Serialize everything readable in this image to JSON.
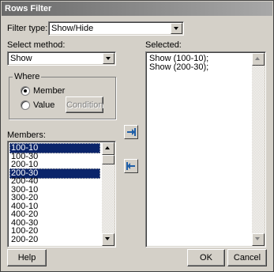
{
  "window": {
    "title": "Rows Filter"
  },
  "filter_type": {
    "label": "Filter type:",
    "value": "Show/Hide"
  },
  "select_method": {
    "label": "Select method:",
    "value": "Show"
  },
  "where": {
    "title": "Where",
    "member_label": "Member",
    "value_label": "Value",
    "condition_label": "Condition",
    "selected_option": "Member"
  },
  "members": {
    "label": "Members:",
    "items": [
      "100-10",
      "100-30",
      "200-10",
      "200-30",
      "200-40",
      "300-10",
      "300-20",
      "400-10",
      "400-20",
      "400-30",
      "100-20",
      "200-20"
    ],
    "selected": [
      "100-10",
      "200-30"
    ]
  },
  "selected_list": {
    "label": "Selected:",
    "items": [
      "Show (100-10);",
      "Show (200-30);"
    ]
  },
  "buttons": {
    "help": "Help",
    "ok": "OK",
    "cancel": "Cancel"
  },
  "icons": {
    "add": "arrow-right-icon",
    "remove": "arrow-left-icon"
  },
  "colors": {
    "selection": "#0a246a",
    "face": "#d4d0c8",
    "move_icon": "#1f5fa8"
  }
}
